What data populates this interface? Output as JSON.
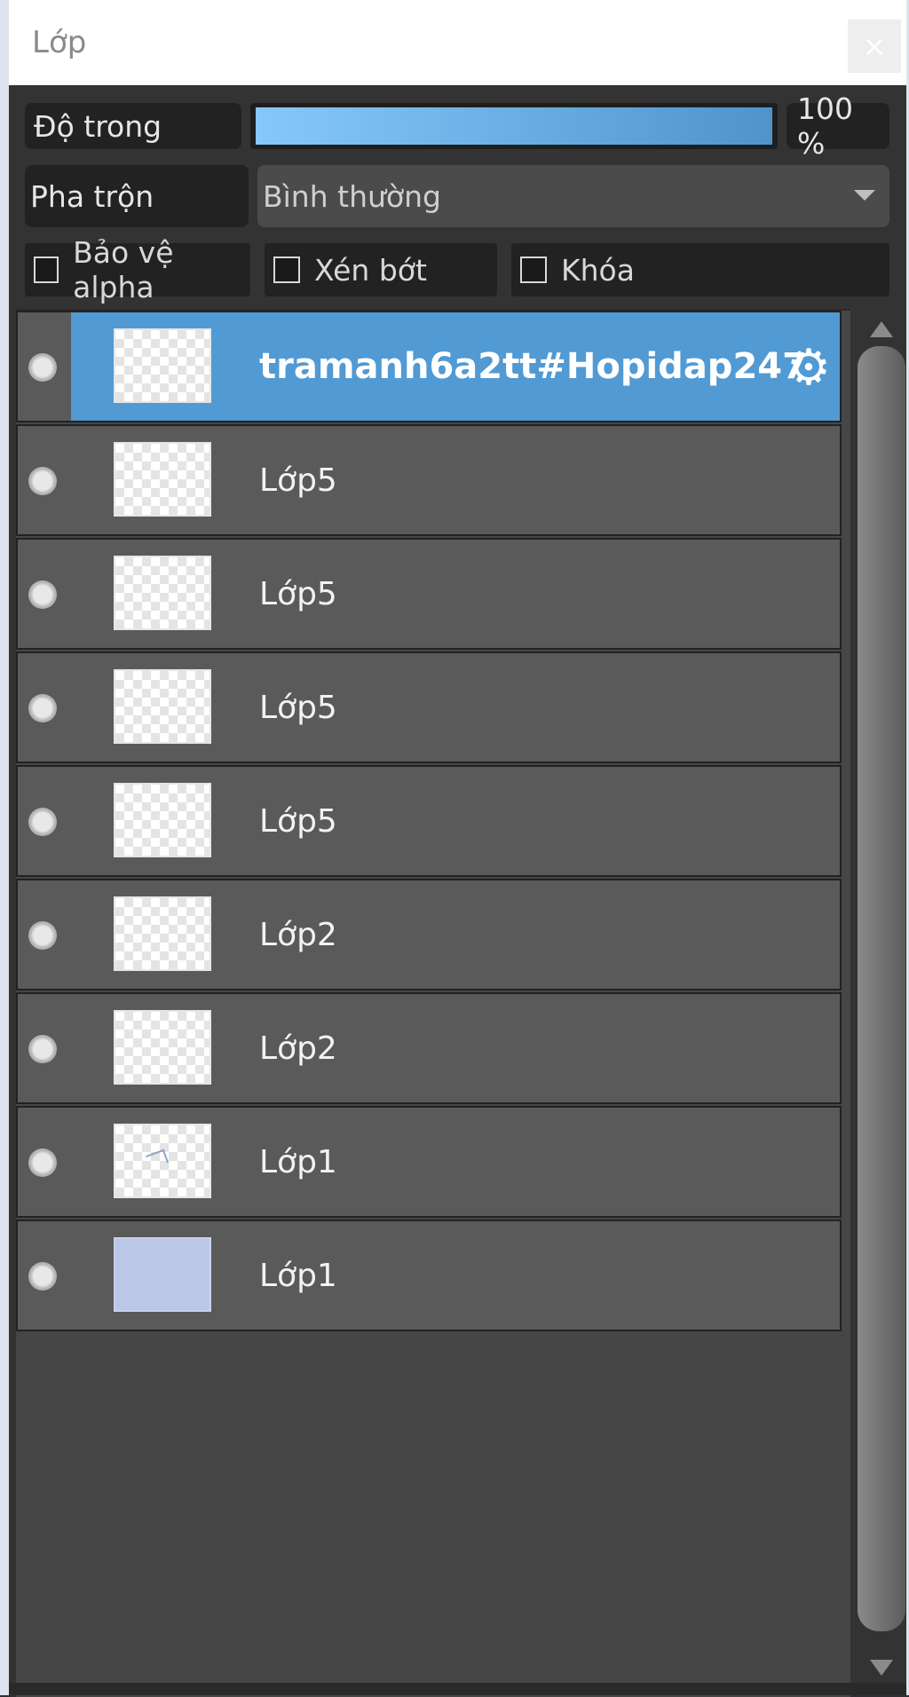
{
  "window": {
    "title": "Lớp",
    "close_label": "×"
  },
  "controls": {
    "opacity_label": "Độ trong",
    "opacity_value": "100 %",
    "opacity_fraction": 1.0,
    "blend_label": "Pha trộn",
    "blend_value": "Bình thường",
    "checkboxes": [
      {
        "label": "Bảo vệ alpha",
        "checked": false
      },
      {
        "label": "Xén bớt",
        "checked": false
      },
      {
        "label": "Khóa",
        "checked": false
      }
    ]
  },
  "layers": [
    {
      "name": "tramanh6a2tt#Hopidap247",
      "selected": true,
      "thumb": "transparent"
    },
    {
      "name": "Lớp5",
      "selected": false,
      "thumb": "transparent"
    },
    {
      "name": "Lớp5",
      "selected": false,
      "thumb": "transparent"
    },
    {
      "name": "Lớp5",
      "selected": false,
      "thumb": "transparent"
    },
    {
      "name": "Lớp5",
      "selected": false,
      "thumb": "transparent"
    },
    {
      "name": "Lớp2",
      "selected": false,
      "thumb": "transparent"
    },
    {
      "name": "Lớp2",
      "selected": false,
      "thumb": "transparent"
    },
    {
      "name": "Lớp1",
      "selected": false,
      "thumb": "sketch"
    },
    {
      "name": "Lớp1",
      "selected": false,
      "thumb": "solid"
    }
  ],
  "colors": {
    "selected": "#519ad4",
    "row": "#5a5a5a",
    "panel": "#333333"
  },
  "icons": {
    "visibility": "eye-dot-icon",
    "settings": "gear-icon",
    "close": "close-icon"
  }
}
